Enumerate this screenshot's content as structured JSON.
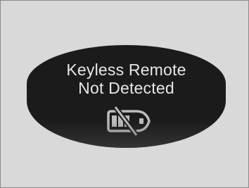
{
  "display": {
    "message_line1": "Keyless Remote",
    "message_line2": "Not Detected",
    "icon": "keyless-remote-not-detected-icon"
  },
  "colors": {
    "frame_background": "#d9d9d9",
    "display_background": "#1b1b1b",
    "text": "#e6e6e6",
    "icon": "#bdbdbd"
  }
}
